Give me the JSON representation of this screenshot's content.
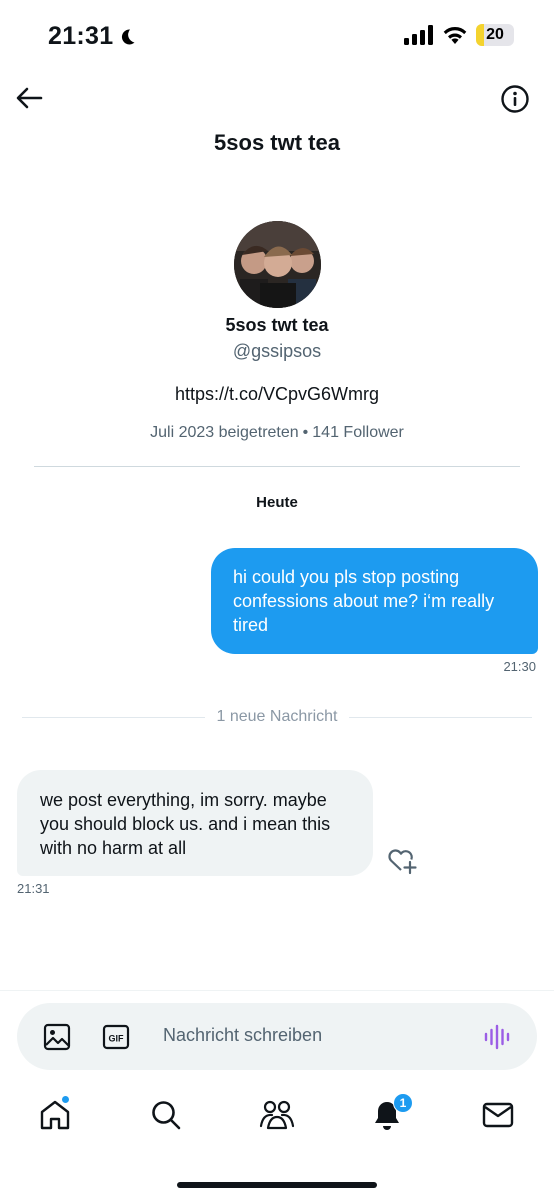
{
  "status_bar": {
    "time": "21:31",
    "battery_level": "20",
    "battery_fraction": 0.2,
    "icons": [
      "moon-icon",
      "signal-icon",
      "wifi-icon",
      "battery-icon"
    ]
  },
  "header": {
    "title": "5sos twt tea",
    "icons": [
      "back-arrow-icon",
      "info-icon"
    ]
  },
  "profile": {
    "name": "5sos twt tea",
    "handle": "@gssipsos",
    "link": "https://t.co/VCpvG6Wmrg",
    "joined": "Juli 2023 beigetreten",
    "separator": "•",
    "followers": "141 Follower"
  },
  "conversation": {
    "day_label": "Heute",
    "messages": [
      {
        "direction": "outgoing",
        "text": "hi could you pls stop posting confessions about me? i‘m really tired",
        "time": "21:30"
      },
      {
        "direction": "incoming",
        "text": "we post everything, im sorry. maybe you should block us. and i mean this with no harm at all",
        "time": "21:31"
      }
    ],
    "new_message_divider": "1 neue Nachricht"
  },
  "composer": {
    "placeholder": "Nachricht schreiben",
    "icons": [
      "image-icon",
      "gif-icon",
      "voice-icon"
    ]
  },
  "tab_bar": {
    "tabs": [
      "home",
      "search",
      "communities",
      "notifications",
      "messages"
    ],
    "notifications_badge": "1"
  },
  "colors": {
    "accent": "#1d9bf0",
    "incoming_bubble": "#eff3f4",
    "secondary_text": "#536471",
    "battery_low": "#f4d32e",
    "voice_icon": "#9b5de5"
  }
}
